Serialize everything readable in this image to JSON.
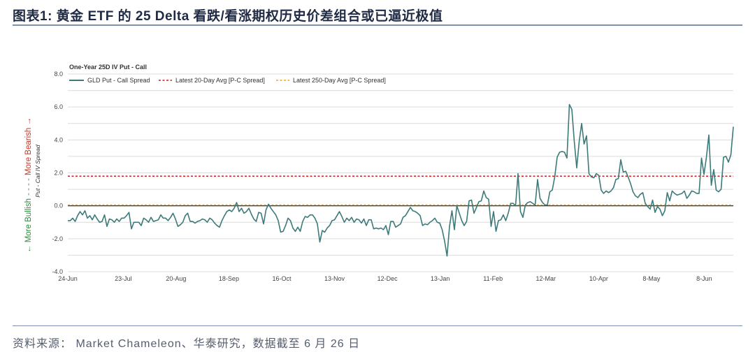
{
  "figure": {
    "title": "图表1:  黄金 ETF 的 25 Delta 看跌/看涨期权历史价差组合或已逼近极值",
    "source": "资料来源： Market Chameleon、华泰研究，数据截至 6 月 26 日"
  },
  "colors": {
    "series": "#3d7a7a",
    "avg20": "#cc1f1f",
    "avg250": "#e8a820",
    "zero": "#1a1a1a",
    "bull": "#2e8b3d",
    "bear": "#c0392b",
    "grid": "#dcdcdc"
  },
  "chart_data": {
    "type": "line",
    "title": "One-Year 25D IV Put - Call",
    "ylabel": "Put - Call IV Spread",
    "ylabel_bull": "← More Bullish",
    "ylabel_sep": "- - - -",
    "ylabel_bear": "More Bearish →",
    "ylim": [
      -4.0,
      8.0
    ],
    "yticks": [
      8.0,
      6.0,
      4.0,
      2.0,
      0.0,
      -2.0,
      -4.0
    ],
    "ytick_labels": [
      "8.0",
      "6.0",
      "4.0",
      "2.0",
      "0.0",
      "-2.0",
      "-4.0"
    ],
    "xlim": [
      0,
      252
    ],
    "xticks": [
      {
        "label": "24-Jun",
        "x": 0
      },
      {
        "label": "23-Jul",
        "x": 21
      },
      {
        "label": "20-Aug",
        "x": 41
      },
      {
        "label": "18-Sep",
        "x": 61
      },
      {
        "label": "16-Oct",
        "x": 81
      },
      {
        "label": "13-Nov",
        "x": 101
      },
      {
        "label": "12-Dec",
        "x": 121
      },
      {
        "label": "13-Jan",
        "x": 141
      },
      {
        "label": "11-Feb",
        "x": 161
      },
      {
        "label": "12-Mar",
        "x": 181
      },
      {
        "label": "10-Apr",
        "x": 201
      },
      {
        "label": "8-May",
        "x": 221
      },
      {
        "label": "8-Jun",
        "x": 241
      }
    ],
    "grid": true,
    "legend_position": "top-left",
    "series": [
      {
        "name": "GLD Put - Call Spread",
        "style": "solid",
        "values": [
          -0.9,
          -0.9,
          -0.75,
          -0.95,
          -0.6,
          -0.35,
          -0.55,
          -0.3,
          -0.75,
          -0.6,
          -0.85,
          -0.55,
          -0.8,
          -1.0,
          -0.95,
          -0.55,
          -1.25,
          -0.8,
          -0.85,
          -1.0,
          -0.8,
          -0.95,
          -0.75,
          -0.75,
          -0.6,
          -0.4,
          -1.4,
          -1.0,
          -1.0,
          -1.0,
          -1.2,
          -0.75,
          -0.85,
          -1.0,
          -0.7,
          -0.95,
          -0.9,
          -0.85,
          -0.55,
          -0.75,
          -0.75,
          -0.9,
          -0.7,
          -0.45,
          -0.8,
          -1.25,
          -1.15,
          -1.0,
          -0.6,
          -0.45,
          -0.95,
          -0.95,
          -1.05,
          -0.95,
          -0.9,
          -0.8,
          -0.85,
          -1.0,
          -0.75,
          -0.85,
          -1.05,
          -1.2,
          -1.3,
          -0.9,
          -0.6,
          -0.35,
          -0.25,
          -0.35,
          -0.15,
          0.2,
          -0.35,
          -0.15,
          -0.45,
          -0.35,
          -0.15,
          -0.5,
          -0.8,
          -0.95,
          -0.4,
          -0.45,
          -1.1,
          -0.25,
          0.1,
          -0.15,
          -0.35,
          -0.55,
          -0.9,
          -1.6,
          -1.55,
          -1.2,
          -0.75,
          -0.9,
          -1.35,
          -1.55,
          -1.3,
          -1.55,
          -0.95,
          -0.65,
          -0.7,
          -0.55,
          -0.55,
          -0.75,
          -1.1,
          -2.2,
          -1.5,
          -1.6,
          -1.35,
          -1.2,
          -0.9,
          -0.85,
          -0.6,
          -0.35,
          -0.65,
          -1.0,
          -0.75,
          -0.9,
          -0.7,
          -1.0,
          -0.8,
          -0.85,
          -1.05,
          -0.8,
          -1.2,
          -0.85,
          -0.85,
          -1.4,
          -1.35,
          -1.4,
          -1.35,
          -1.45,
          -1.2,
          -1.75,
          -0.95,
          -0.95,
          -1.3,
          -1.2,
          -1.1,
          -0.7,
          -0.6,
          -0.35,
          -0.1,
          -0.3,
          -0.35,
          -0.45,
          -0.6,
          -1.2,
          -1.1,
          -1.15,
          -1.0,
          -0.9,
          -0.75,
          -1.0,
          -1.05,
          -1.45,
          -2.15,
          -3.05,
          -1.25,
          -0.3,
          -1.45,
          0.0,
          -0.45,
          -0.9,
          -1.2,
          -0.95,
          0.3,
          0.35,
          -0.45,
          -0.1,
          0.25,
          0.3,
          0.9,
          0.5,
          0.4,
          -1.25,
          -0.35,
          -1.55,
          -0.9,
          -0.85,
          -0.55,
          -0.9,
          -0.45,
          0.15,
          0.15,
          0.0,
          1.95,
          -0.35,
          -0.7,
          0.05,
          0.2,
          0.25,
          0.15,
          0.05,
          1.6,
          0.45,
          0.2,
          0.05,
          0.05,
          0.85,
          0.95,
          1.75,
          2.95,
          3.25,
          3.3,
          3.25,
          2.9,
          6.15,
          5.85,
          3.9,
          2.3,
          3.9,
          5.0,
          3.75,
          4.25,
          1.95,
          1.75,
          1.7,
          1.95,
          1.85,
          0.95,
          0.75,
          0.9,
          0.8,
          0.9,
          1.1,
          1.6,
          1.65,
          2.8,
          2.05,
          2.1,
          1.75,
          1.35,
          0.85,
          0.6,
          0.5,
          0.7,
          0.8,
          0.15,
          -0.05,
          -0.2,
          0.35,
          -0.4,
          -0.05,
          -0.2,
          -0.6,
          -0.3,
          0.8,
          0.3,
          0.9,
          0.75,
          0.65,
          0.7,
          0.75,
          0.9,
          0.45,
          0.65,
          0.9,
          0.85,
          0.75,
          0.75,
          2.9,
          1.9,
          2.95,
          4.3,
          1.25,
          2.2,
          0.95,
          0.85,
          1.0,
          2.95,
          3.0,
          2.65,
          3.1,
          4.8
        ]
      },
      {
        "name": "Latest 20-Day Avg [P-C Spread]",
        "style": "dashed",
        "constant": 1.8
      },
      {
        "name": "Latest 250-Day Avg [P-C Spread]",
        "style": "dashed",
        "constant": 0.05
      }
    ]
  }
}
